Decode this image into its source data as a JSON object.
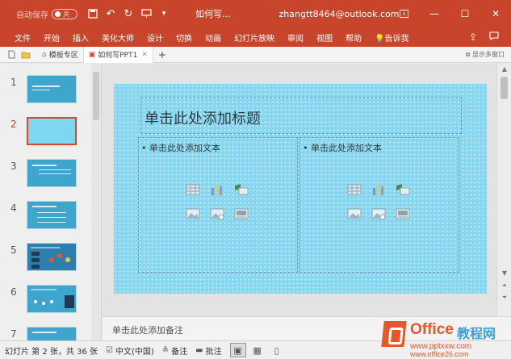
{
  "titlebar": {
    "autosave_label": "自动保存",
    "autosave_state": "关",
    "doc_title": "如何写...",
    "account": "zhangtt8464@outlook.com"
  },
  "ribbon": {
    "tabs": [
      "文件",
      "开始",
      "插入",
      "美化大师",
      "设计",
      "切换",
      "动画",
      "幻灯片放映",
      "审阅",
      "视图",
      "帮助",
      "告诉我"
    ]
  },
  "doctabs": {
    "tabs": [
      "模板专区",
      "如何写PPT1"
    ],
    "add": "+",
    "multi_window": "显示多窗口"
  },
  "thumbnails": {
    "numbers": [
      "1",
      "2",
      "3",
      "4",
      "5",
      "6",
      "7"
    ],
    "selected": "2"
  },
  "slide": {
    "title_placeholder": "单击此处添加标题",
    "left_content": "• 单击此处添加文本",
    "right_content": "• 单击此处添加文本"
  },
  "notes": {
    "placeholder": "单击此处添加备注"
  },
  "status": {
    "slide_info": "幻灯片 第 2 张，共 36 张",
    "language": "中文(中国)",
    "notes_btn": "备注",
    "comments_btn": "批注"
  },
  "watermark": {
    "brand": "Office",
    "brand_cn": "教程网",
    "url": "www.pptxxw.com",
    "url2": "www.office26.com"
  },
  "colors": {
    "accent": "#c8442a",
    "slide_bg": "#86d6ef"
  }
}
